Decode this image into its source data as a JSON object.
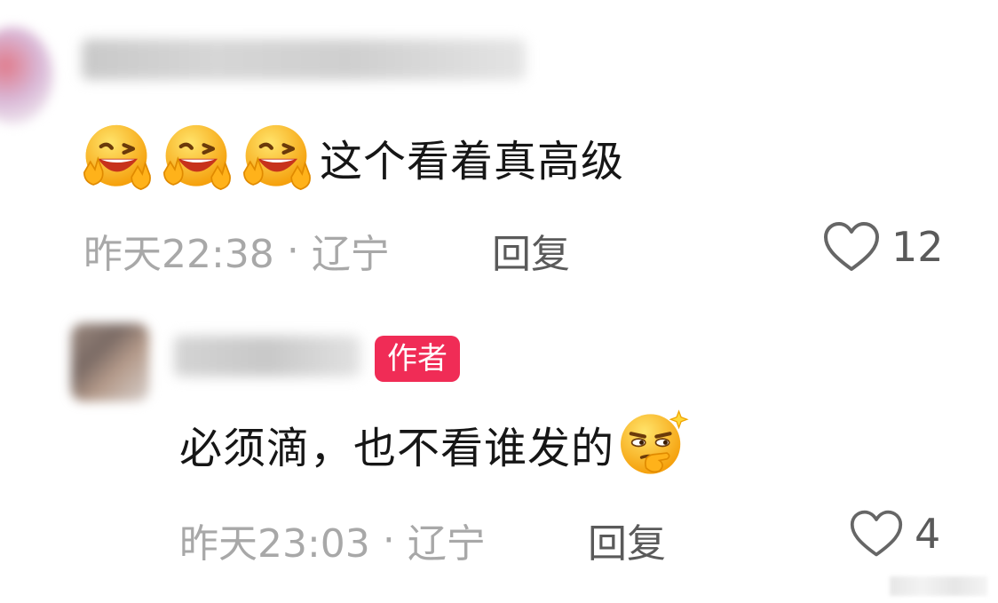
{
  "colors": {
    "author_badge_bg": "#f02c56",
    "meta_text": "#a8a8a8",
    "reply_text": "#5a5a5a",
    "comment_text": "#161616"
  },
  "comments": [
    {
      "text": "这个看着真高级",
      "emojis": [
        "laughing-v-sign-emoji",
        "laughing-v-sign-emoji",
        "laughing-v-sign-emoji"
      ],
      "time": "昨天22:38",
      "separator": "·",
      "location": "辽宁",
      "reply_label": "回复",
      "like_icon": "heart-icon",
      "like_count": "12"
    },
    {
      "author_badge": "作者",
      "text": "必须滴，也不看谁发的",
      "emojis": [
        "smug-thinking-emoji"
      ],
      "time": "昨天23:03",
      "separator": "·",
      "location": "辽宁",
      "reply_label": "回复",
      "like_icon": "heart-icon",
      "like_count": "4"
    }
  ]
}
